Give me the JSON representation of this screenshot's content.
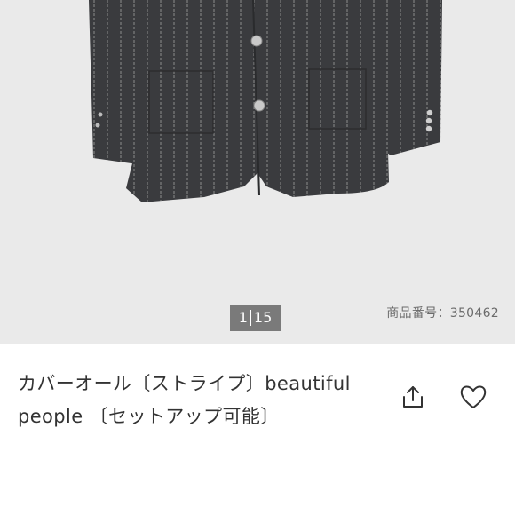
{
  "gallery": {
    "counter_current": "1",
    "counter_total": "15",
    "product_code": "商品番号：350462"
  },
  "product": {
    "title": "カバーオール〔ストライプ〕beautiful people 〔セットアップ可能〕"
  },
  "icons": {
    "share": "share-icon",
    "favorite": "heart-icon"
  },
  "colors": {
    "gallery_bg": "#eaeaea",
    "counter_bg": "#7a7a7a",
    "text": "#333333"
  }
}
